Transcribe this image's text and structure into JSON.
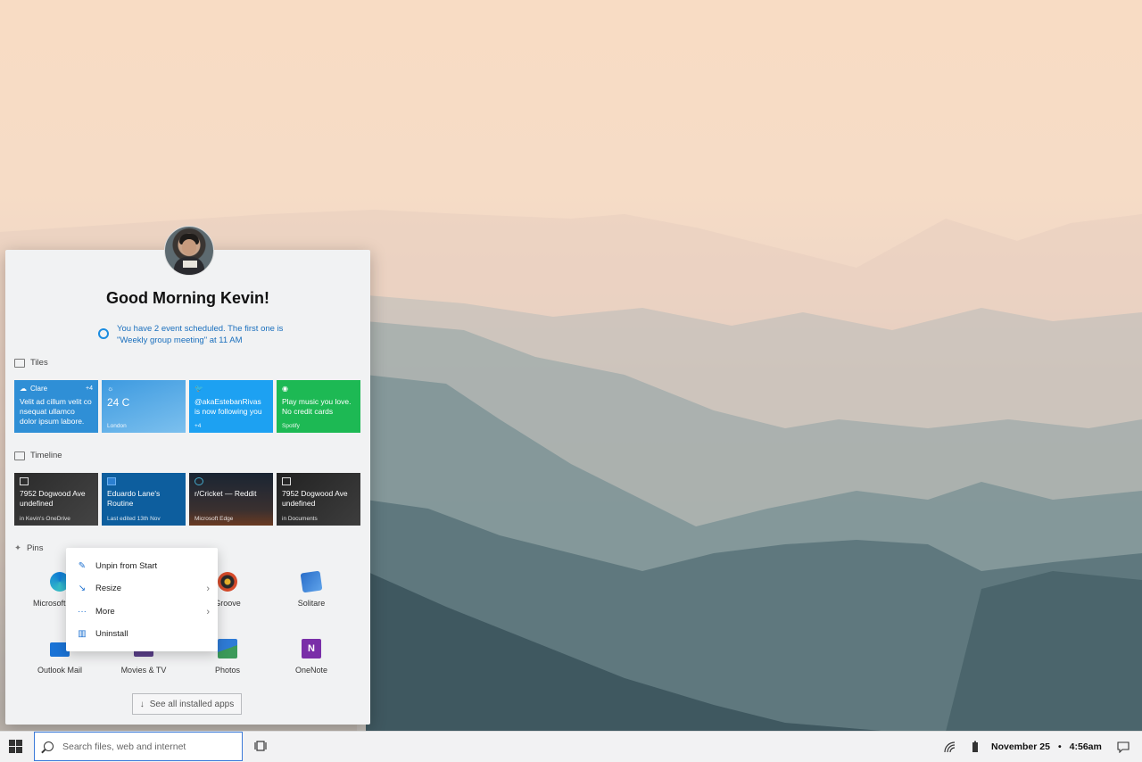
{
  "start": {
    "greeting": "Good Morning Kevin!",
    "event_text": "You have 2 event scheduled. The first one is \"Weekly group meeting\" at 11 AM",
    "sections": {
      "tiles": "Tiles",
      "timeline": "Timeline",
      "pins": "Pins"
    },
    "tiles": [
      {
        "name": "Clare",
        "badge": "+4",
        "body": "Velit ad cillum velit co nsequat ullamco dolor ipsum labore.",
        "color": "#2f8fd6"
      },
      {
        "big": "24 C",
        "foot": "London",
        "color": "#4aa6e6"
      },
      {
        "body": "@akaEstebanRivas is now following you",
        "foot": "+4",
        "color": "#1da1f2"
      },
      {
        "body": "Play music you love. No credit cards",
        "foot": "Spotify",
        "color": "#1db954"
      }
    ],
    "timeline": [
      {
        "title": "7952 Dogwood Ave undefined",
        "foot": "in Kevin's OneDrive"
      },
      {
        "title": "Eduardo Lane's Routine",
        "foot": "Last edited 13th Nov"
      },
      {
        "title": "r/Cricket — Reddit",
        "foot": "Microsoft Edge"
      },
      {
        "title": "7952 Dogwood Ave undefined",
        "foot": "in Documents"
      }
    ],
    "pins": [
      {
        "label": "Microsoft Edge",
        "icon": "edge-icon"
      },
      {
        "label": "",
        "icon": "placeholder"
      },
      {
        "label": "Groove",
        "icon": "groove-icon"
      },
      {
        "label": "Solitare",
        "icon": "solitaire-icon"
      },
      {
        "label": "Outlook Mail",
        "icon": "mail-icon"
      },
      {
        "label": "Movies & TV",
        "icon": "movies-icon"
      },
      {
        "label": "Photos",
        "icon": "photos-icon"
      },
      {
        "label": "OneNote",
        "icon": "onenote-icon"
      }
    ],
    "see_all": "See all installed apps"
  },
  "context_menu": {
    "items": [
      {
        "label": "Unpin from Start",
        "icon": "unpin-icon"
      },
      {
        "label": "Resize",
        "icon": "resize-icon",
        "submenu": true
      },
      {
        "label": "More",
        "icon": "more-icon",
        "submenu": true
      },
      {
        "label": "Uninstall",
        "icon": "trash-icon"
      }
    ]
  },
  "taskbar": {
    "search_placeholder": "Search files, web and internet",
    "date": "November 25",
    "time": "4:56am",
    "separator": "•"
  },
  "colors": {
    "accent": "#1b6fd0",
    "edge_blue": "#0f7bd6"
  }
}
